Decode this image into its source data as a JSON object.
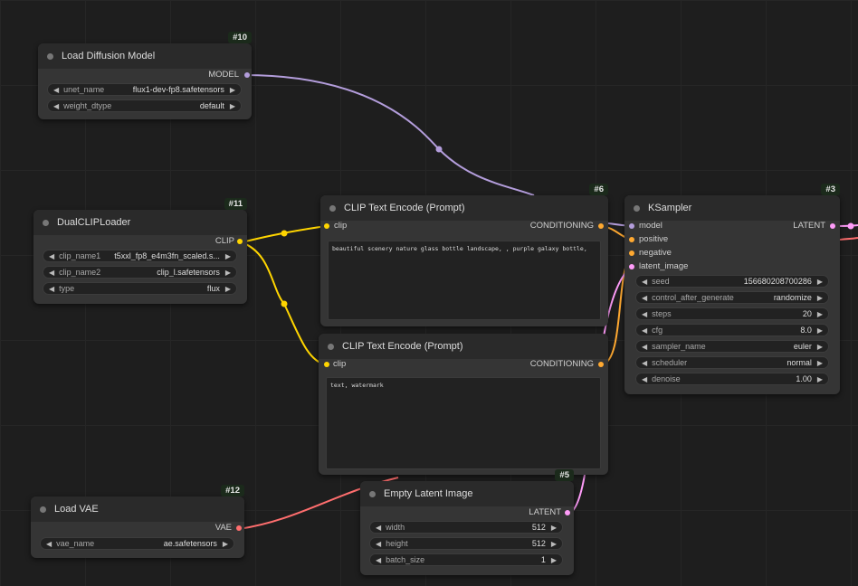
{
  "colors": {
    "model": "#b39ddb",
    "clip": "#ffd500",
    "conditioning": "#ffa931",
    "latent": "#ff9cf9",
    "vae": "#ff6e6e"
  },
  "nodes": {
    "load_diffusion": {
      "id": "#10",
      "title": "Load Diffusion Model",
      "output": "MODEL",
      "widgets": [
        {
          "name": "unet_name",
          "value": "flux1-dev-fp8.safetensors"
        },
        {
          "name": "weight_dtype",
          "value": "default"
        }
      ]
    },
    "dual_clip": {
      "id": "#11",
      "title": "DualCLIPLoader",
      "output": "CLIP",
      "widgets": [
        {
          "name": "clip_name1",
          "value": "t5xxl_fp8_e4m3fn_scaled.s..."
        },
        {
          "name": "clip_name2",
          "value": "clip_l.safetensors"
        },
        {
          "name": "type",
          "value": "flux"
        }
      ]
    },
    "clip_pos": {
      "id": "#6",
      "title": "CLIP Text Encode (Prompt)",
      "input": "clip",
      "output": "CONDITIONING",
      "text": "beautiful scenery nature glass bottle landscape, , purple galaxy bottle,"
    },
    "clip_neg": {
      "title": "CLIP Text Encode (Prompt)",
      "input": "clip",
      "output": "CONDITIONING",
      "text": "text, watermark"
    },
    "ksampler": {
      "id": "#3",
      "title": "KSampler",
      "output": "LATENT",
      "inputs": [
        "model",
        "positive",
        "negative",
        "latent_image"
      ],
      "widgets": [
        {
          "name": "seed",
          "value": "156680208700286"
        },
        {
          "name": "control_after_generate",
          "value": "randomize"
        },
        {
          "name": "steps",
          "value": "20"
        },
        {
          "name": "cfg",
          "value": "8.0"
        },
        {
          "name": "sampler_name",
          "value": "euler"
        },
        {
          "name": "scheduler",
          "value": "normal"
        },
        {
          "name": "denoise",
          "value": "1.00"
        }
      ]
    },
    "load_vae": {
      "id": "#12",
      "title": "Load VAE",
      "output": "VAE",
      "widgets": [
        {
          "name": "vae_name",
          "value": "ae.safetensors"
        }
      ]
    },
    "empty_latent": {
      "id": "#5",
      "title": "Empty Latent Image",
      "output": "LATENT",
      "widgets": [
        {
          "name": "width",
          "value": "512"
        },
        {
          "name": "height",
          "value": "512"
        },
        {
          "name": "batch_size",
          "value": "1"
        }
      ]
    }
  }
}
